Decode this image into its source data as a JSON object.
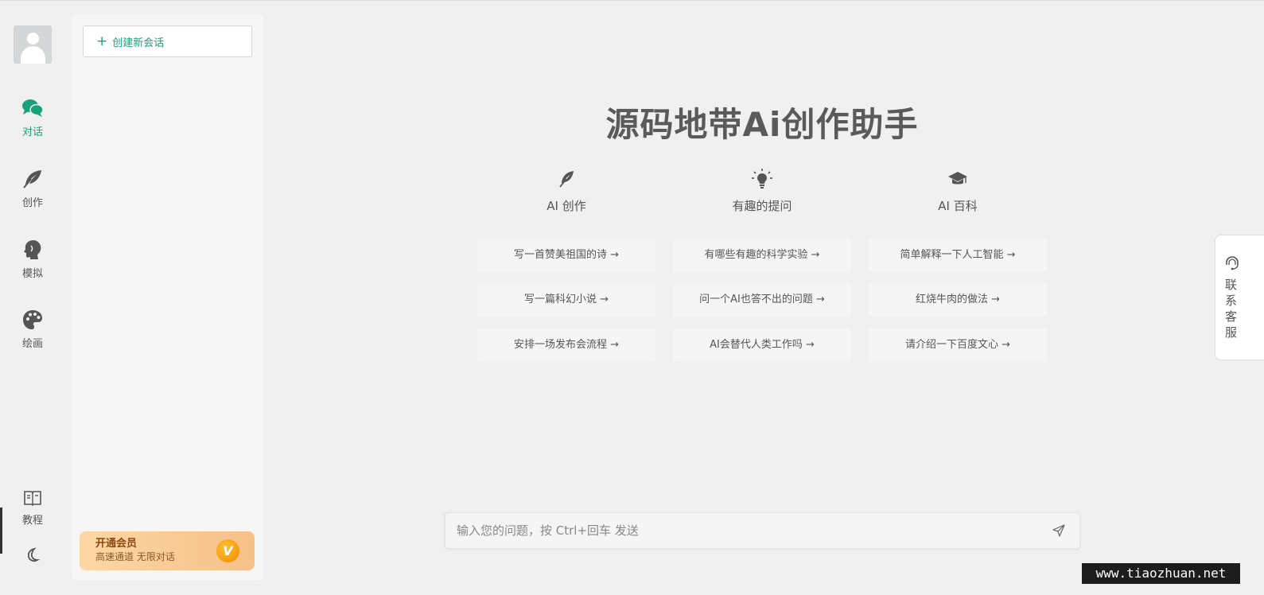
{
  "rail": {
    "items": [
      {
        "label": "对话",
        "icon": "chat-icon",
        "active": true
      },
      {
        "label": "创作",
        "icon": "feather-icon"
      },
      {
        "label": "模拟",
        "icon": "head-profile-icon"
      },
      {
        "label": "绘画",
        "icon": "palette-icon"
      },
      {
        "label": "教程",
        "icon": "book-icon"
      }
    ],
    "theme_icon": "moon-icon"
  },
  "panel": {
    "new_chat_label": "创建新会话",
    "vip": {
      "title": "开通会员",
      "subtitle": "高速通道 无限对话",
      "badge": "V"
    }
  },
  "main": {
    "title": "源码地带Ai创作助手",
    "categories": [
      {
        "label": "AI 创作",
        "icon": "feather-icon",
        "suggestions": [
          "写一首赞美祖国的诗 →",
          "写一篇科幻小说 →",
          "安排一场发布会流程 →"
        ]
      },
      {
        "label": "有趣的提问",
        "icon": "lightbulb-icon",
        "suggestions": [
          "有哪些有趣的科学实验 →",
          "问一个AI也答不出的问题 →",
          "AI会替代人类工作吗 →"
        ]
      },
      {
        "label": "AI 百科",
        "icon": "graduation-cap-icon",
        "suggestions": [
          "简单解释一下人工智能 →",
          "红烧牛肉的做法 →",
          "请介绍一下百度文心 →"
        ]
      }
    ]
  },
  "input": {
    "placeholder": "输入您的问题，按 Ctrl+回车 发送",
    "value": ""
  },
  "contact": {
    "label": "联系客服"
  },
  "watermark": "www.tiaozhuan.net",
  "colors": {
    "accent": "#17a27a",
    "background": "#eff0ef",
    "vip_start": "#fcd7a4",
    "vip_end": "#f6c088"
  }
}
